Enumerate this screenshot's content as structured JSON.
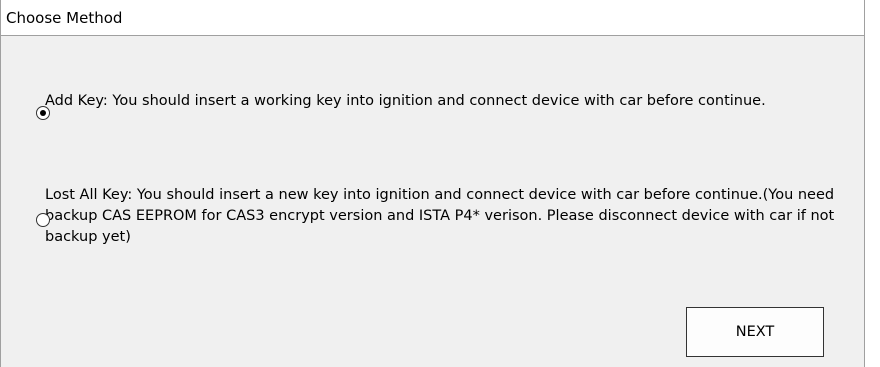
{
  "window": {
    "title": "Choose Method"
  },
  "options": [
    {
      "label": "Add Key: You should insert a working key into ignition and connect device with car before continue.",
      "selected": true
    },
    {
      "label": "Lost All Key: You should insert a new key into ignition and connect device with car before continue.(You need backup CAS EEPROM for CAS3 encrypt version and ISTA P4* verison. Please disconnect device with car if not backup yet)",
      "selected": false
    }
  ],
  "buttons": {
    "next_label": "NEXT"
  }
}
